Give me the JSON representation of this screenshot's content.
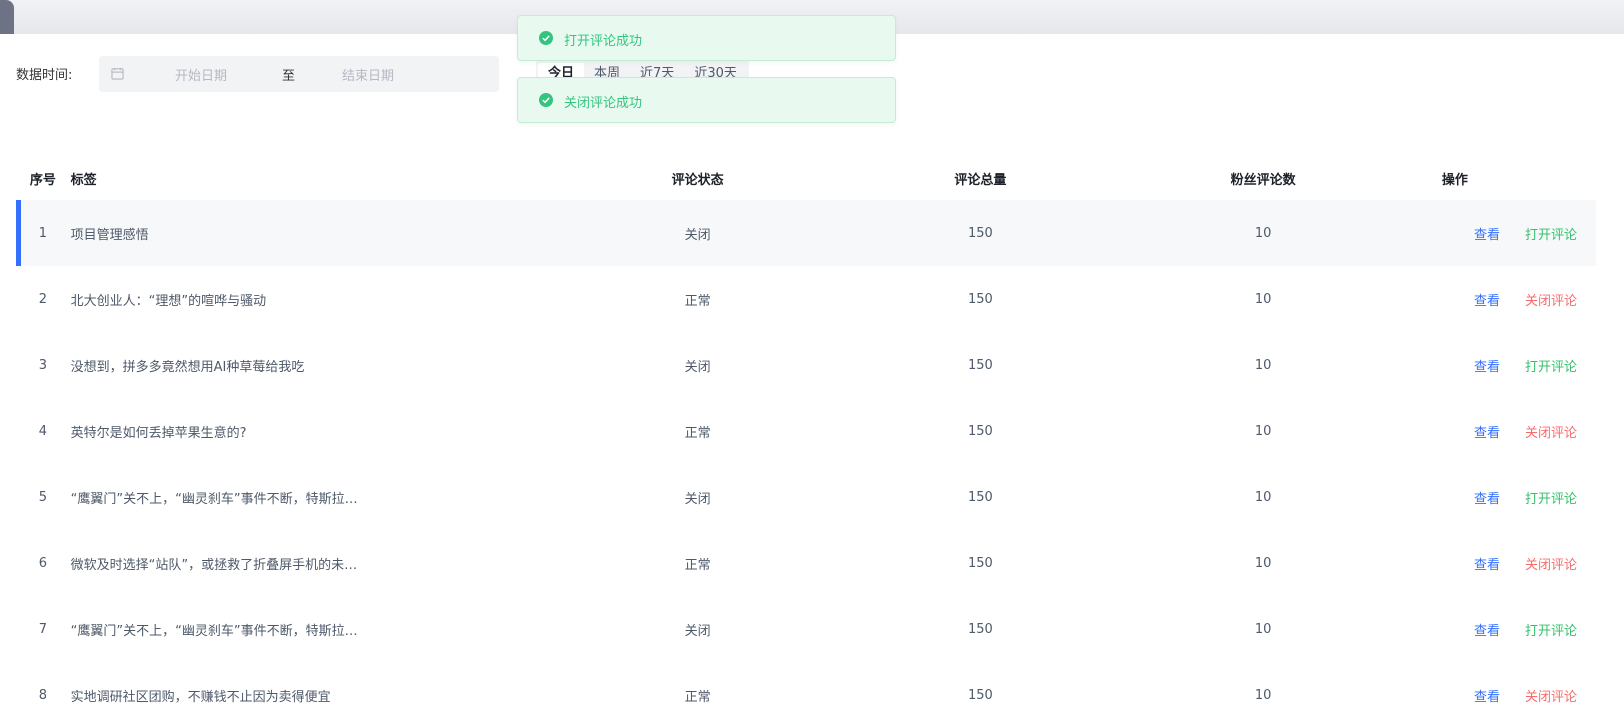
{
  "filter": {
    "label": "数据时间:",
    "start_placeholder": "开始日期",
    "separator": "至",
    "end_placeholder": "结束日期",
    "quick_ranges": [
      "今日",
      "本周",
      "近7天",
      "近30天"
    ],
    "active_range": "今日"
  },
  "toasts": [
    {
      "text": "打开评论成功",
      "type": "success"
    },
    {
      "text": "关闭评论成功",
      "type": "success"
    }
  ],
  "table": {
    "columns": [
      "序号",
      "标签",
      "评论状态",
      "评论总量",
      "粉丝评论数",
      "操作"
    ],
    "rows": [
      {
        "index": "1",
        "tag": "项目管理感悟",
        "status": "关闭",
        "total": "150",
        "fans": "10",
        "view": "查看",
        "toggle": "打开评论"
      },
      {
        "index": "2",
        "tag": "北大创业人：“理想”的喧哗与骚动",
        "status": "正常",
        "total": "150",
        "fans": "10",
        "view": "查看",
        "toggle": "关闭评论"
      },
      {
        "index": "3",
        "tag": "没想到，拼多多竟然想用AI种草莓给我吃",
        "status": "关闭",
        "total": "150",
        "fans": "10",
        "view": "查看",
        "toggle": "打开评论"
      },
      {
        "index": "4",
        "tag": "英特尔是如何丢掉苹果生意的?",
        "status": "正常",
        "total": "150",
        "fans": "10",
        "view": "查看",
        "toggle": "关闭评论"
      },
      {
        "index": "5",
        "tag": "“鹰翼门”关不上，“幽灵刹车”事件不断，特斯拉…",
        "status": "关闭",
        "total": "150",
        "fans": "10",
        "view": "查看",
        "toggle": "打开评论"
      },
      {
        "index": "6",
        "tag": "微软及时选择“站队”，或拯救了折叠屏手机的未…",
        "status": "正常",
        "total": "150",
        "fans": "10",
        "view": "查看",
        "toggle": "关闭评论"
      },
      {
        "index": "7",
        "tag": "“鹰翼门”关不上，“幽灵刹车”事件不断，特斯拉…",
        "status": "关闭",
        "total": "150",
        "fans": "10",
        "view": "查看",
        "toggle": "打开评论"
      },
      {
        "index": "8",
        "tag": "实地调研社区团购，不赚钱不止因为卖得便宜",
        "status": "正常",
        "total": "150",
        "fans": "10",
        "view": "查看",
        "toggle": "关闭评论"
      }
    ]
  },
  "colors": {
    "primary": "#3370ff",
    "open_action": "#34c16a",
    "close_action": "#f56c6c",
    "toast_bg": "#e8faf0",
    "toast_text": "#35c47f"
  }
}
